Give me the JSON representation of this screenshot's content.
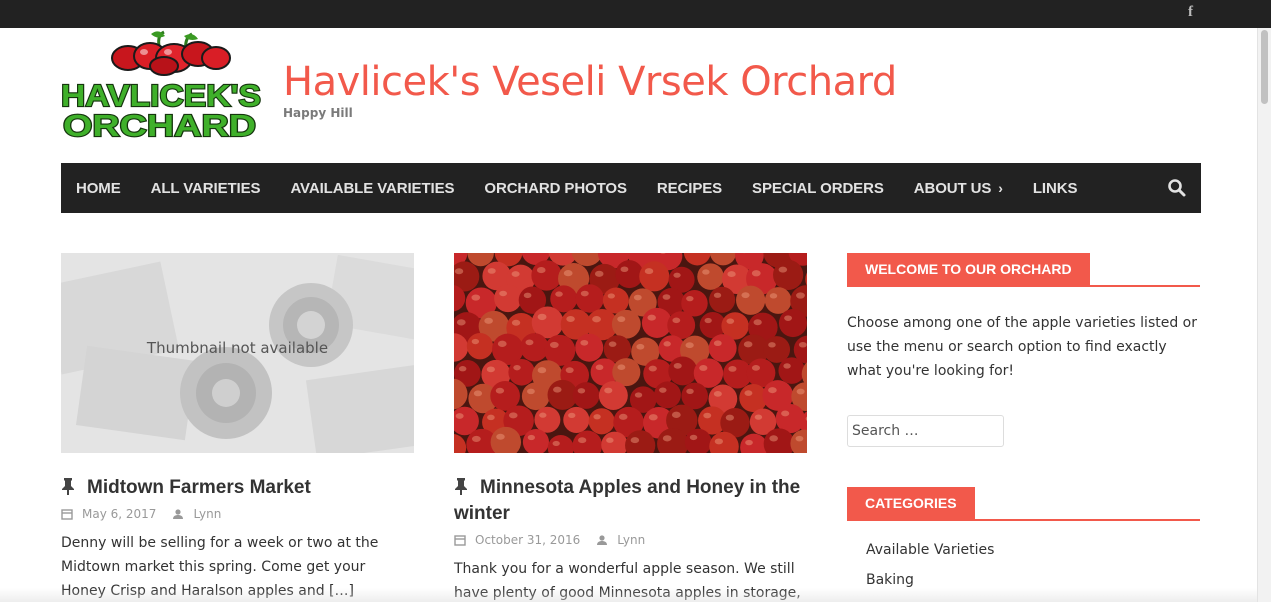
{
  "topbar": {
    "social_icon": "facebook-icon",
    "facebook_glyph": "f"
  },
  "logo": {
    "line1": "HAVLICEK'S",
    "line2": "ORCHARD"
  },
  "header": {
    "title": "Havlicek's Veseli Vrsek Orchard",
    "tagline": "Happy Hill"
  },
  "nav": {
    "items": [
      {
        "label": "HOME"
      },
      {
        "label": "ALL VARIETIES"
      },
      {
        "label": "AVAILABLE VARIETIES"
      },
      {
        "label": "ORCHARD PHOTOS"
      },
      {
        "label": "RECIPES"
      },
      {
        "label": "SPECIAL ORDERS"
      },
      {
        "label": "ABOUT US"
      },
      {
        "label": "LINKS"
      }
    ],
    "search_icon": "search-icon"
  },
  "posts": [
    {
      "thumbnail_text": "Thumbnail not available",
      "title": "Midtown Farmers Market",
      "date": "May 6, 2017",
      "author": "Lynn",
      "excerpt": "Denny will be selling for a week or two at the Midtown market this spring.  Come get your Honey Crisp and Haralson apples and […]"
    },
    {
      "title": "Minnesota Apples and Honey in the winter",
      "date": "October 31, 2016",
      "author": "Lynn",
      "excerpt": "Thank you for a wonderful apple season.  We still have plenty of good Minnesota apples in storage, so"
    }
  ],
  "sidebar": {
    "welcome": {
      "title": "WELCOME TO OUR ORCHARD",
      "text": "Choose among one of the apple varieties listed or use the menu or search option to find exactly what you're looking for!"
    },
    "search": {
      "placeholder": "Search …"
    },
    "categories": {
      "title": "CATEGORIES",
      "items": [
        {
          "label": "Available Varieties"
        },
        {
          "label": "Baking"
        }
      ]
    }
  },
  "colors": {
    "accent": "#f2594b",
    "dark": "#222222",
    "nav_text": "#e2e2e2"
  }
}
